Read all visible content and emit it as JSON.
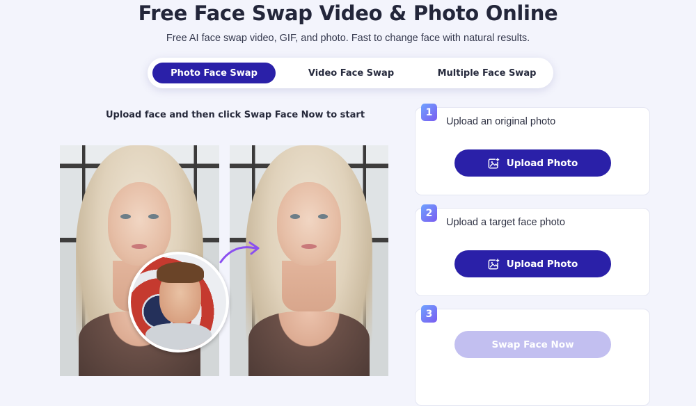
{
  "header": {
    "title": "Free Face Swap Video & Photo Online",
    "subtitle": "Free AI face swap video, GIF, and photo. Fast to change face with natural results."
  },
  "tabs": [
    {
      "label": "Photo Face Swap",
      "active": true
    },
    {
      "label": "Video Face Swap",
      "active": false
    },
    {
      "label": "Multiple Face Swap",
      "active": false
    }
  ],
  "demo": {
    "instruction": "Upload face and then click Swap Face Now to start"
  },
  "steps": [
    {
      "number": "1",
      "label": "Upload an original photo",
      "button_label": "Upload Photo",
      "button_icon": "image-upload-icon"
    },
    {
      "number": "2",
      "label": "Upload a target face photo",
      "button_label": "Upload Photo",
      "button_icon": "image-upload-icon"
    },
    {
      "number": "3",
      "label": "",
      "button_label": "Swap Face Now",
      "button_state": "disabled"
    }
  ],
  "colors": {
    "accent": "#2a20a8",
    "disabled_button": "#c2bff0",
    "background": "#f3f4fc",
    "step_badge_gradient": [
      "#6fa3ff",
      "#7a5cf0"
    ]
  }
}
